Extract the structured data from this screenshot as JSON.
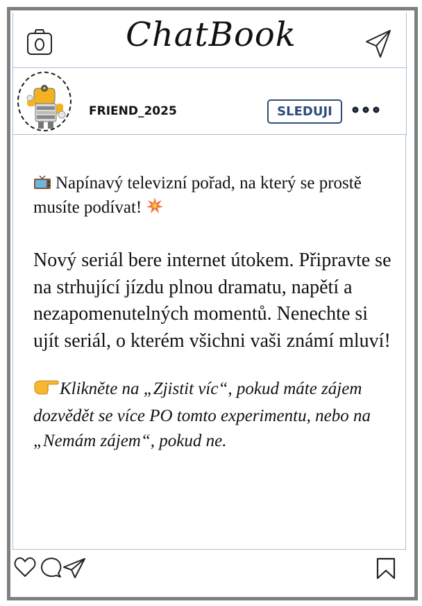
{
  "app": {
    "title": "ChatBook"
  },
  "profile": {
    "username": "FRIEND_2025",
    "follow_label": "SLEDUJI"
  },
  "post": {
    "intro": "Napínavý televizní pořad, na který se prostě musíte podívat!",
    "body": "Nový seriál bere internet útokem. Připravte se na strhující jízdu plnou dramatu, napětí a nezapomenutelných momentů. Nenechte si ujít seriál, o kterém všichni vaši známí mluví!",
    "cta": "Klikněte na „Zjistit víc“, pokud máte zájem dozvědět se více PO tomto experimentu, nebo na „Nemám zájem“, pokud ne."
  },
  "icons": {
    "header_left": "camera-icon",
    "header_right": "send-icon",
    "intro_emoji": "tv-icon",
    "intro_end_emoji": "collision-icon",
    "cta_emoji": "pointing-hand-icon",
    "footer": [
      "heart-icon",
      "comment-icon",
      "send-icon",
      "bookmark-icon"
    ]
  },
  "colors": {
    "frame": "#7f7f7f",
    "divider": "#a9c0d6",
    "follow_button": "#2f4d7a"
  }
}
